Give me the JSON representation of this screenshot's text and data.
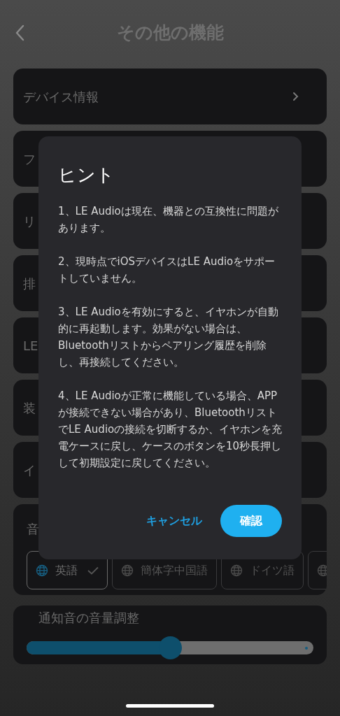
{
  "header": {
    "title": "その他の機能"
  },
  "settings": [
    {
      "kind": "link",
      "label": "デバイス情報"
    },
    {
      "kind": "plain",
      "label": "フ"
    },
    {
      "kind": "plain",
      "label": "リ"
    },
    {
      "kind": "plain",
      "label": "排"
    },
    {
      "kind": "plain",
      "label": "LE"
    },
    {
      "kind": "plain",
      "label": "装"
    },
    {
      "kind": "plain",
      "label": "イ"
    },
    {
      "kind": "languages",
      "label": "音",
      "options": [
        {
          "label": "英語",
          "selected": true
        },
        {
          "label": "簡体字中国語",
          "selected": false
        },
        {
          "label": "ドイツ語",
          "selected": false
        },
        {
          "selected": false
        }
      ]
    },
    {
      "kind": "slider",
      "label": "通知音の音量調整",
      "level": 0.5
    }
  ],
  "dialog": {
    "title": "ヒント",
    "paragraphs": [
      "1、LE Audioは現在、機器との互換性に問題があります。",
      "2、現時点でiOSデバイスはLE Audioをサポートしていません。",
      "3、LE Audioを有効にすると、イヤホンが自動的に再起動します。効果がない場合は、Bluetoothリストからペアリング履歴を削除し、再接続してください。",
      "4、LE Audioが正常に機能している場合、APPが接続できない場合があり、BluetoothリストでLE Audioの接続を切断するか、イヤホンを充電ケースに戻し、ケースのボタンを10秒長押しして初期設定に戻してください。"
    ],
    "buttons": [
      {
        "kind": "text",
        "label": "キャンセル"
      },
      {
        "kind": "primary",
        "label": "確認"
      }
    ]
  }
}
